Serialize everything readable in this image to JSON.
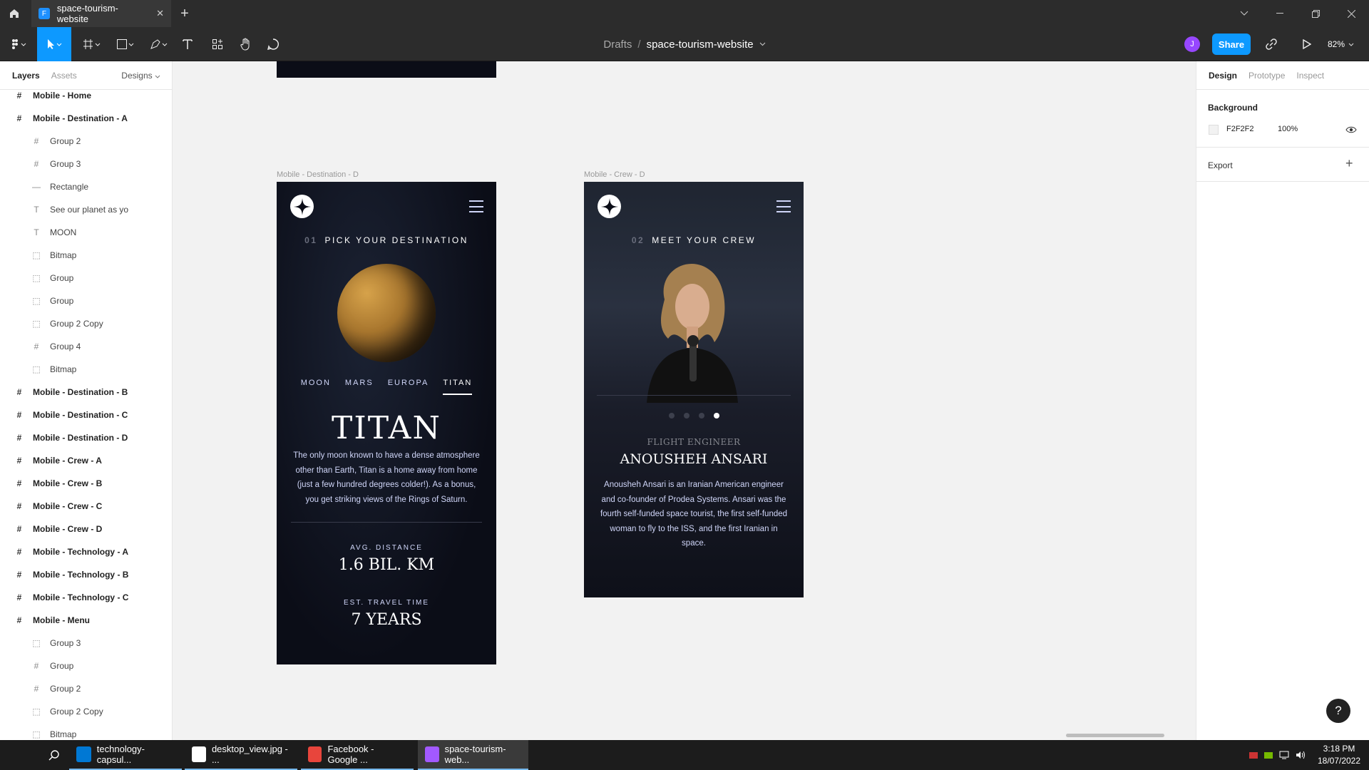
{
  "titlebar": {
    "tab_label": "space-tourism-website",
    "close": "✕",
    "new_tab": "+",
    "favicon": "figma-icon"
  },
  "toolbar": {
    "crumb_parent": "Drafts",
    "crumb_sep": "/",
    "file_name": "space-tourism-website",
    "avatar_initial": "J",
    "share_label": "Share",
    "zoom": "82%"
  },
  "left_panel": {
    "tabs": [
      "Layers",
      "Assets"
    ],
    "pages_label": "Designs",
    "layers": [
      {
        "name": "Mobile - Home",
        "type": "frame",
        "level": 0
      },
      {
        "name": "Mobile - Destination - A",
        "type": "frame",
        "level": 0
      },
      {
        "name": "Group 2",
        "type": "group",
        "level": 1
      },
      {
        "name": "Group 3",
        "type": "group",
        "level": 1
      },
      {
        "name": "Rectangle",
        "type": "rect",
        "level": 1
      },
      {
        "name": "See our planet as yo",
        "type": "text",
        "level": 1
      },
      {
        "name": "MOON",
        "type": "text",
        "level": 1
      },
      {
        "name": "Bitmap",
        "type": "image",
        "level": 1
      },
      {
        "name": "Group",
        "type": "image",
        "level": 1
      },
      {
        "name": "Group",
        "type": "image",
        "level": 1
      },
      {
        "name": "Group 2 Copy",
        "type": "image",
        "level": 1
      },
      {
        "name": "Group 4",
        "type": "group",
        "level": 1
      },
      {
        "name": "Bitmap",
        "type": "image",
        "level": 1
      },
      {
        "name": "Mobile - Destination - B",
        "type": "frame",
        "level": 0
      },
      {
        "name": "Mobile - Destination - C",
        "type": "frame",
        "level": 0
      },
      {
        "name": "Mobile - Destination - D",
        "type": "frame",
        "level": 0
      },
      {
        "name": "Mobile - Crew - A",
        "type": "frame",
        "level": 0
      },
      {
        "name": "Mobile - Crew - B",
        "type": "frame",
        "level": 0
      },
      {
        "name": "Mobile - Crew - C",
        "type": "frame",
        "level": 0
      },
      {
        "name": "Mobile - Crew - D",
        "type": "frame",
        "level": 0
      },
      {
        "name": "Mobile - Technology - A",
        "type": "frame",
        "level": 0
      },
      {
        "name": "Mobile - Technology - B",
        "type": "frame",
        "level": 0
      },
      {
        "name": "Mobile - Technology - C",
        "type": "frame",
        "level": 0
      },
      {
        "name": "Mobile - Menu",
        "type": "frame",
        "level": 0
      },
      {
        "name": "Group 3",
        "type": "image",
        "level": 1
      },
      {
        "name": "Group",
        "type": "group",
        "level": 1
      },
      {
        "name": "Group 2",
        "type": "group",
        "level": 1
      },
      {
        "name": "Group 2 Copy",
        "type": "image",
        "level": 1
      },
      {
        "name": "Bitmap",
        "type": "image",
        "level": 1
      }
    ]
  },
  "canvas": {
    "frame_dest_label": "Mobile - Destination - D",
    "frame_crew_label": "Mobile - Crew - D",
    "destination": {
      "eyebrow_num": "01",
      "eyebrow_text": "PICK YOUR DESTINATION",
      "tabs": [
        "MOON",
        "MARS",
        "EUROPA",
        "TITAN"
      ],
      "active_tab": 3,
      "name": "TITAN",
      "description": "The only moon known to have a dense atmosphere other than Earth, Titan is a home away from home (just a few hundred degrees colder!). As a bonus, you get striking views of the Rings of Saturn.",
      "distance_label": "AVG. DISTANCE",
      "distance_value": "1.6 BIL. KM",
      "travel_label": "EST. TRAVEL TIME",
      "travel_value": "7 YEARS"
    },
    "crew": {
      "eyebrow_num": "02",
      "eyebrow_text": "MEET YOUR CREW",
      "active_dot": 3,
      "role": "FLIGHT ENGINEER",
      "name": "ANOUSHEH ANSARI",
      "bio": "Anousheh Ansari is an Iranian American engineer and co-founder of Prodea Systems. Ansari was the fourth self-funded space tourist, the first self-funded woman to fly to the ISS, and the first Iranian in space."
    }
  },
  "right_panel": {
    "tabs": [
      "Design",
      "Prototype",
      "Inspect"
    ],
    "background_heading": "Background",
    "bg_hex": "F2F2F2",
    "bg_opacity": "100%",
    "export_heading": "Export",
    "export_add": "+"
  },
  "help_label": "?",
  "taskbar": {
    "apps": [
      {
        "label": "technology-capsul...",
        "icon": "vscode-icon",
        "color": "#0078d4"
      },
      {
        "label": "desktop_view.jpg - ...",
        "icon": "photos-icon",
        "color": "#ffffff"
      },
      {
        "label": "Facebook - Google ...",
        "icon": "chrome-icon",
        "color": "#e8453c"
      },
      {
        "label": "space-tourism-web...",
        "icon": "figma-icon",
        "color": "#a259ff"
      }
    ],
    "time": "3:18 PM",
    "date": "18/07/2022"
  }
}
